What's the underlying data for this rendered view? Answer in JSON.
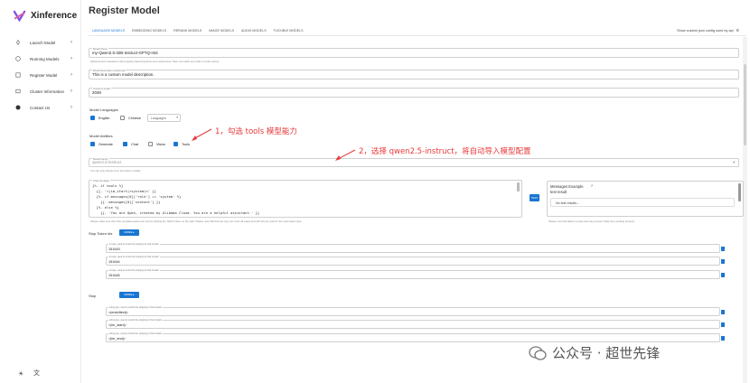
{
  "app": {
    "name": "Xinference"
  },
  "sidebar": {
    "items": [
      {
        "label": "Launch Model"
      },
      {
        "label": "Running Models"
      },
      {
        "label": "Register Model"
      },
      {
        "label": "Cluster Information"
      },
      {
        "label": "Contact Us"
      }
    ]
  },
  "page": {
    "title": "Register Model"
  },
  "tabs": [
    "LANGUAGE MODELS",
    "EMBEDDING MODELS",
    "RERANK MODELS",
    "IMAGE MODELS",
    "AUDIO MODELS",
    "FLEXIBLE MODELS"
  ],
  "json_toggle": "Show custom json config used by api",
  "form": {
    "model_name": {
      "label": "Model Name",
      "value": "my-Qwen2.5-32B-Instruct-GPTQ-Int4",
      "helper": "Alphanumeric characters with properly placed hyphens and underscores. Must not match any built-in model names."
    },
    "model_description": {
      "label": "Model Description (Optional)",
      "value": "This is a custom model description."
    },
    "context_length": {
      "label": "Context Length",
      "value": "2048"
    },
    "languages": {
      "label": "Model Languages",
      "options": [
        {
          "label": "English",
          "checked": true
        },
        {
          "label": "Chinese",
          "checked": false
        }
      ],
      "select_placeholder": "Languages"
    },
    "abilities": {
      "label": "Model Abilities",
      "options": [
        {
          "label": "Generate",
          "checked": true
        },
        {
          "label": "Chat",
          "checked": true
        },
        {
          "label": "Vision",
          "checked": false
        },
        {
          "label": "Tools",
          "checked": true
        }
      ]
    },
    "family": {
      "label": "Model Family",
      "placeholder": "qwen2.5-instruct",
      "helper": "You can only choose from the built-in models"
    },
    "chat_template": {
      "label": "Chat Template",
      "lines": [
        "{%- if tools %}",
        "  {{- '<|im_start|>system\\n' }}",
        "  {%- if messages[0]['role'] == 'system' %}",
        "    {{- messages[0]['content'] }}",
        "  {%- else %}",
        "    {{- 'You are Qwen, created by Alibaba Cloud. You are a helpful assistant.' }}"
      ],
      "helper": "Please make sure this chat_template passes the test by clicking the TEST button on the right. Please note that this test may not cover all cases and will only be used for the most basic case.",
      "test_label": "TEST"
    },
    "messages_example": {
      "title": "Messages Example",
      "subtitle": "test result",
      "no_result": "No test results...",
      "helper": "Please note that failure to pass test may prevent chats from working properly."
    },
    "stop_token_ids": {
      "label": "Stop Token Ids",
      "more_label": "MORE",
      "items": [
        {
          "label": "int type, used to control the stopping of chat models",
          "value": "151643"
        },
        {
          "label": "int type, used to control the stopping of chat models",
          "value": "151644"
        },
        {
          "label": "int type, used to control the stopping of chat models",
          "value": "151645"
        }
      ]
    },
    "stop": {
      "label": "Stop",
      "more_label": "MORE",
      "items": [
        {
          "label": "string type, used to control the stopping of chat models",
          "value": "<|endoftext|>"
        },
        {
          "label": "string type, used to control the stopping of chat models",
          "value": "<|im_start|>"
        },
        {
          "label": "string type, used to control the stopping of chat models",
          "value": "<|im_end|>"
        }
      ]
    }
  },
  "annotations": {
    "step1": "1，勾选 tools 模型能力",
    "step2": "2，选择 qwen2.5-instruct，将自动导入模型配置"
  },
  "watermark": "公众号 · 超世先锋",
  "colors": {
    "primary": "#1976d2",
    "annotation": "#e8393b"
  }
}
